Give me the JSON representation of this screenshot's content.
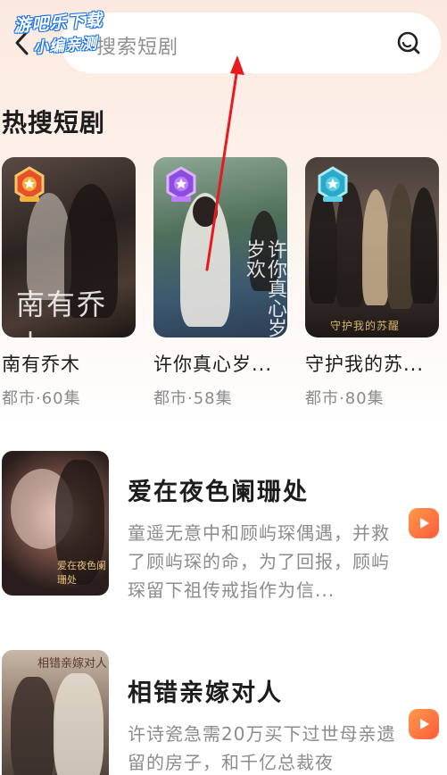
{
  "watermark": {
    "line1": "游吧乐下载",
    "line2": "小编亲测"
  },
  "search": {
    "placeholder": "搜索短剧"
  },
  "hot_section": {
    "title": "热搜短剧",
    "cards": [
      {
        "name": "南有乔木",
        "meta": "都市·60集",
        "poster_text": "南有乔木",
        "badge_color": "#e8502a"
      },
      {
        "name": "许你真心岁...",
        "meta": "都市·58集",
        "poster_text": "许你真心岁岁欢",
        "badge_color": "#8b4ee0"
      },
      {
        "name": "守护我的苏...",
        "meta": "都市·80集",
        "poster_text": "守护我的苏醒",
        "badge_color": "#2aa9c9"
      }
    ]
  },
  "list": [
    {
      "title": "爱在夜色阑珊处",
      "desc": "童遥无意中和顾屿琛偶遇，并救了顾屿琛的命，为了回报，顾屿琛留下祖传戒指作为信...",
      "poster_text": "爱在夜色阑珊处"
    },
    {
      "title": "相错亲嫁对人",
      "desc": "许诗瓷急需20万买下过世母亲遗留的房子，和千亿总裁夜▯▯▯▯▯▯▯▯▯▯▯▯",
      "poster_text": "相错亲嫁对人"
    }
  ],
  "colors": {
    "accent": "#ff6a3c",
    "annotation": "#e8191f"
  }
}
